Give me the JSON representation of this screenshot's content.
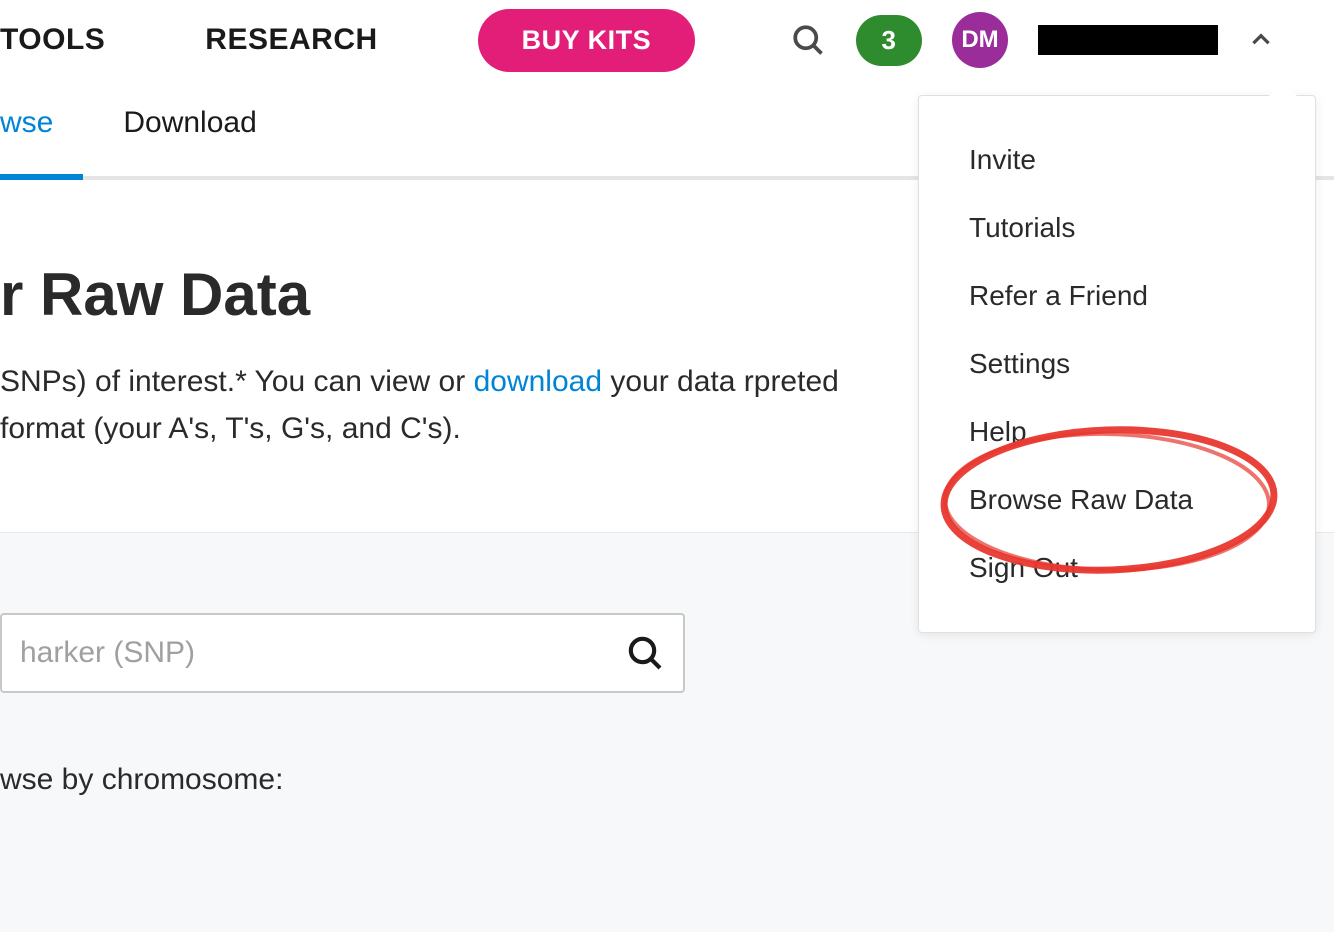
{
  "topnav": {
    "tools": "TOOLS",
    "research": "RESEARCH",
    "buy_kits": "BUY KITS",
    "notif_count": "3",
    "avatar_initials": "DM"
  },
  "subnav": {
    "browse": "wse",
    "download": "Download"
  },
  "page": {
    "title": "r Raw Data",
    "desc_part1": "SNPs) of interest.* You can view or ",
    "desc_link": "download",
    "desc_part2": " your data rpreted format (your A's, T's, G's, and C's)."
  },
  "search": {
    "placeholder": "harker (SNP)"
  },
  "browse_section": {
    "label": "wse by chromosome:"
  },
  "dropdown": {
    "items": [
      "Invite",
      "Tutorials",
      "Refer a Friend",
      "Settings",
      "Help",
      "Browse Raw Data",
      "Sign Out"
    ]
  }
}
